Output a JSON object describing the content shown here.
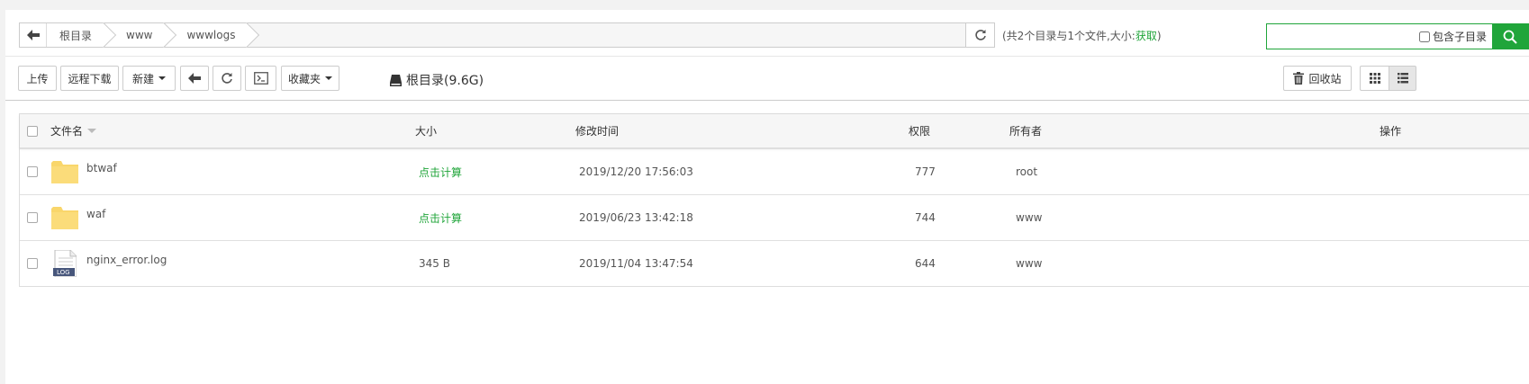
{
  "breadcrumb": {
    "items": [
      "根目录",
      "www",
      "wwwlogs"
    ]
  },
  "summary": {
    "text": "(共2个目录与1个文件,大小:",
    "fetch_label": "获取",
    "close": ")"
  },
  "search": {
    "value": "",
    "placeholder": "",
    "subdir_label": "包含子目录"
  },
  "toolbar": {
    "upload": "上传",
    "remote_download": "远程下载",
    "new": "新建",
    "favorites": "收藏夹",
    "disk_label": "根目录(9.6G)",
    "recycle": "回收站"
  },
  "table": {
    "headers": {
      "name": "文件名",
      "size": "大小",
      "mtime": "修改时间",
      "perm": "权限",
      "owner": "所有者",
      "actions": "操作"
    },
    "rows": [
      {
        "name": "btwaf",
        "type": "folder",
        "size": "点击计算",
        "mtime": "2019/12/20 17:56:03",
        "perm": "777",
        "owner": "root"
      },
      {
        "name": "waf",
        "type": "folder",
        "size": "点击计算",
        "mtime": "2019/06/23 13:42:18",
        "perm": "744",
        "owner": "www"
      },
      {
        "name": "nginx_error.log",
        "type": "log",
        "size": "345 B",
        "mtime": "2019/11/04 13:47:54",
        "perm": "644",
        "owner": "www",
        "icon_text": "LOG"
      }
    ]
  },
  "colors": {
    "accent": "#20a53a",
    "folder": "#f9d66b"
  }
}
